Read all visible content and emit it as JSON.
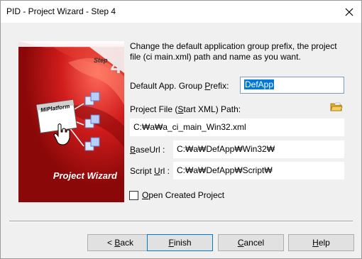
{
  "window": {
    "title": "PID - Project Wizard - Step 4"
  },
  "banner": {
    "step_label": "Step",
    "step_number": "4",
    "product_label": "MiPlatform",
    "caption": "Project Wizard"
  },
  "description": "Change the default application group prefix, the project file (ci main.xml) path and name as you want.",
  "prefix": {
    "label_pre": "Default App. Group ",
    "label_key": "P",
    "label_post": "refix:",
    "value": "DefApp"
  },
  "project_file": {
    "label_pre": "Project File (",
    "label_key": "S",
    "label_post": "tart XML) Path:",
    "value": "C:₩a₩a_ci_main_Win32.xml"
  },
  "base_url": {
    "label_key": "B",
    "label_post": "aseUrl :",
    "value": "C:₩a₩DefApp₩Win32₩"
  },
  "script_url": {
    "label_pre": "Script ",
    "label_key": "U",
    "label_post": "rl :",
    "value": "C:₩a₩DefApp₩Script₩"
  },
  "open_project": {
    "label_key": "O",
    "label_post": "pen Created Project",
    "checked": false
  },
  "buttons": {
    "back_pre": "< ",
    "back_key": "B",
    "back_post": "ack",
    "finish_key": "F",
    "finish_post": "inish",
    "cancel_key": "C",
    "cancel_post": "ancel",
    "help_key": "H",
    "help_post": "elp"
  },
  "icons": {
    "close": "close-icon",
    "browse": "folder-icon",
    "cursor": "hand-cursor-icon"
  },
  "colors": {
    "banner_red": "#a80d0d",
    "selection": "#0078d7",
    "focus_border": "#0078d7"
  }
}
